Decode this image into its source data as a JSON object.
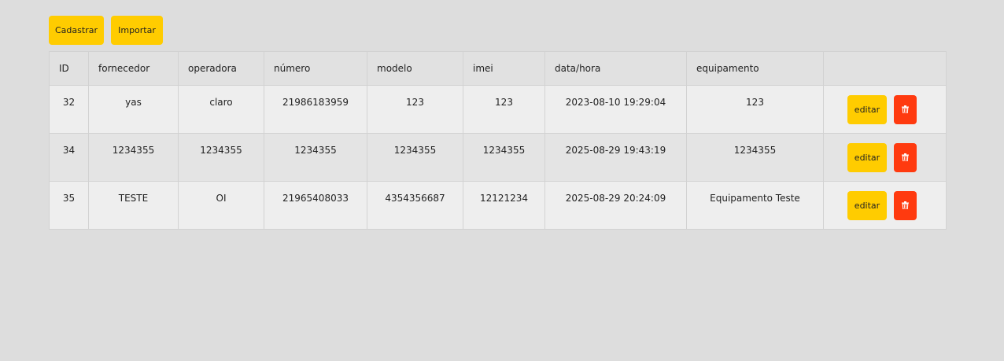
{
  "toolbar": {
    "cadastrar_label": "Cadastrar",
    "importar_label": "Importar"
  },
  "table": {
    "columns": [
      "ID",
      "fornecedor",
      "operadora",
      "número",
      "modelo",
      "imei",
      "data/hora",
      "equipamento",
      ""
    ],
    "edit_label": "editar",
    "rows": [
      {
        "id": "32",
        "fornecedor": "yas",
        "operadora": "claro",
        "numero": "21986183959",
        "modelo": "123",
        "imei": "123",
        "datahora": "2023-08-10 19:29:04",
        "equipamento": "123"
      },
      {
        "id": "34",
        "fornecedor": "1234355",
        "operadora": "1234355",
        "numero": "1234355",
        "modelo": "1234355",
        "imei": "1234355",
        "datahora": "2025-08-29 19:43:19",
        "equipamento": "1234355"
      },
      {
        "id": "35",
        "fornecedor": "TESTE",
        "operadora": "OI",
        "numero": "21965408033",
        "modelo": "4354356687",
        "imei": "12121234",
        "datahora": "2025-08-29 20:24:09",
        "equipamento": "Equipamento Teste"
      }
    ]
  },
  "colors": {
    "background": "#dddddd",
    "button_yellow": "#ffcc00",
    "button_delete": "#ff3a0f"
  },
  "icons": {
    "delete": "trash-icon"
  }
}
